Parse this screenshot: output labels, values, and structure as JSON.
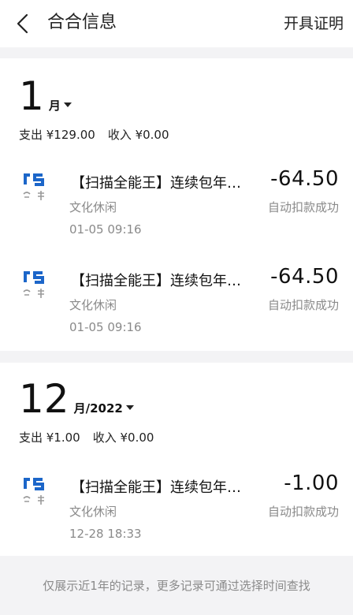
{
  "header": {
    "title": "合合信息",
    "action": "开具证明"
  },
  "sections": [
    {
      "month": "1",
      "suffix": "月",
      "expense_label": "支出 ¥129.00",
      "income_label": "收入 ¥0.00",
      "transactions": [
        {
          "name": "【扫描全能王】连续包年…",
          "category": "文化休闲",
          "time": "01-05  09:16",
          "amount": "-64.50",
          "status": "自动扣款成功"
        },
        {
          "name": "【扫描全能王】连续包年…",
          "category": "文化休闲",
          "time": "01-05  09:16",
          "amount": "-64.50",
          "status": "自动扣款成功"
        }
      ]
    },
    {
      "month": "12",
      "suffix": "月/2022",
      "expense_label": "支出 ¥1.00",
      "income_label": "收入 ¥0.00",
      "transactions": [
        {
          "name": "【扫描全能王】连续包年…",
          "category": "文化休闲",
          "time": "12-28  18:33",
          "amount": "-1.00",
          "status": "自动扣款成功"
        }
      ]
    }
  ],
  "footer": {
    "note": "仅展示近1年的记录，更多记录可通过选择时间查找"
  },
  "colors": {
    "logo_blue": "#1c66c9",
    "logo_gray": "#9a9a9a"
  }
}
